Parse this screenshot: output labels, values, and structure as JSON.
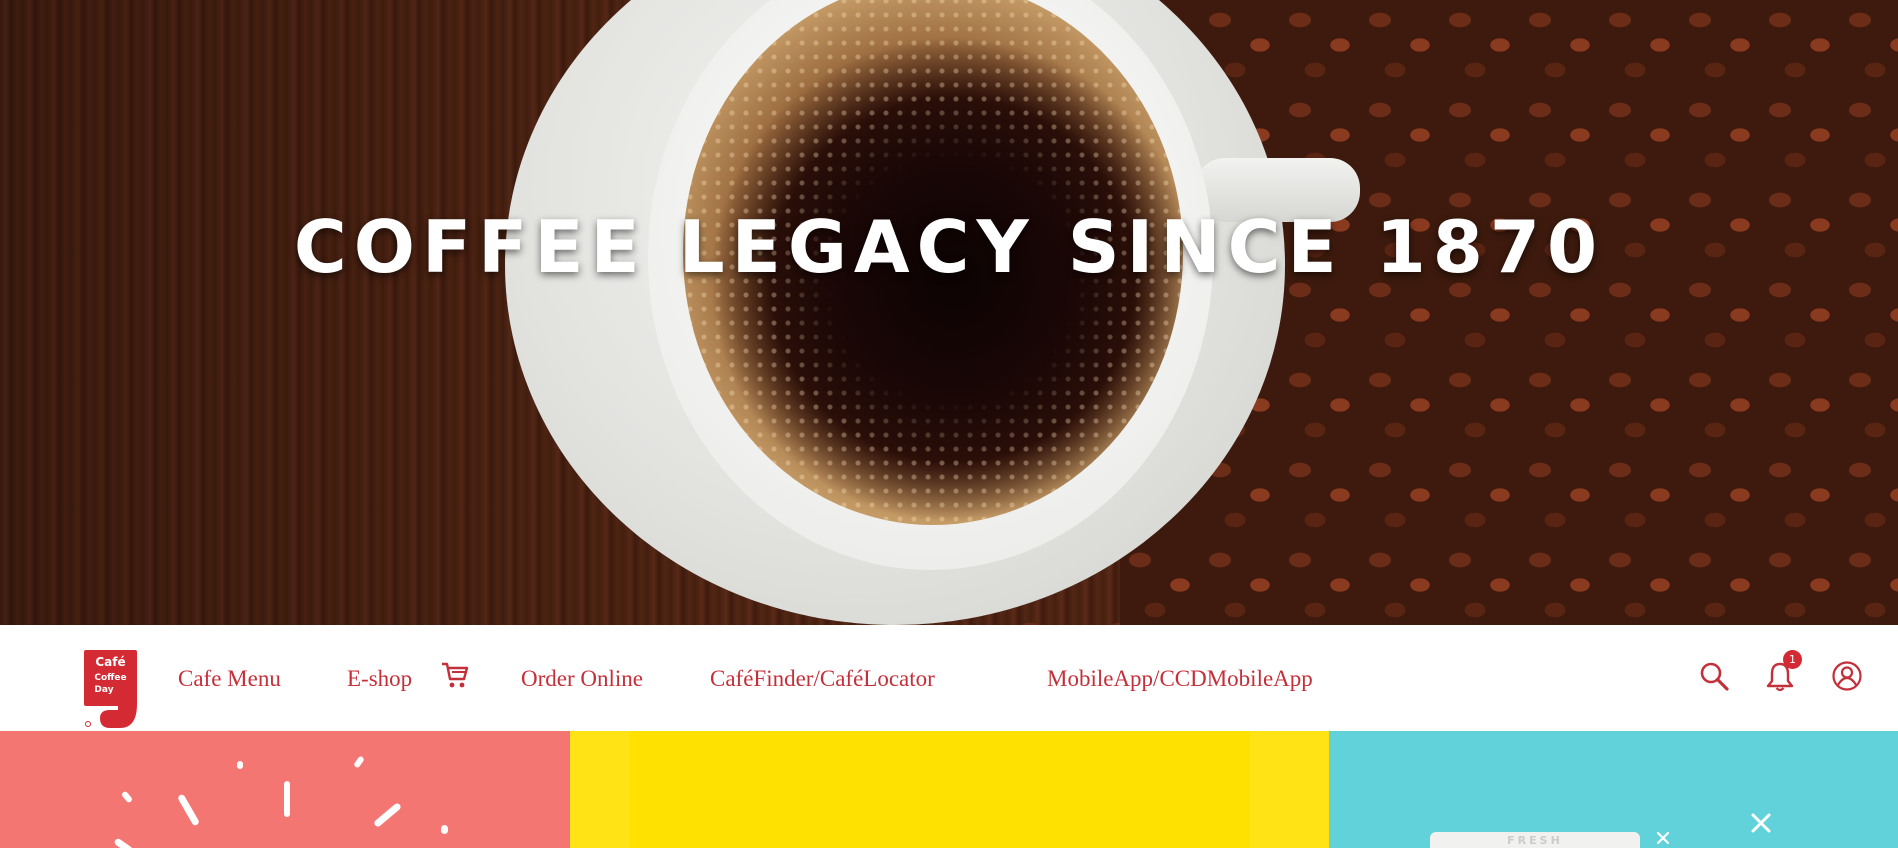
{
  "hero": {
    "title": "COFFEE LEGACY SINCE 1870"
  },
  "navbar": {
    "logo_text_lines": [
      "Café",
      "Coffee",
      "Day"
    ],
    "items": [
      {
        "label": "Cafe Menu"
      },
      {
        "label": "E-shop"
      },
      {
        "label": "Order Online"
      },
      {
        "label": "CaféFinder/CaféLocator"
      },
      {
        "label": "MobileApp/CCDMobileApp"
      }
    ],
    "icons": [
      "shopping-cart-icon",
      "search-icon",
      "bell-icon",
      "user-icon"
    ],
    "notification_count": "1"
  },
  "colors": {
    "brand_red": "#c4303a",
    "badge_red": "#d42a34",
    "panel_coral": "#f47672",
    "panel_yellow": "#ffe100",
    "panel_cyan": "#62d2da"
  },
  "panels": {
    "cyan_box_text": "FRESH"
  }
}
